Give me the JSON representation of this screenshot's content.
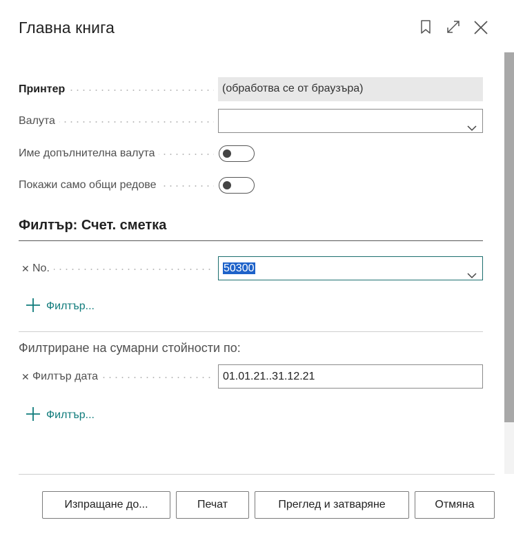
{
  "dialog": {
    "title": "Главна книга"
  },
  "header_icons": [
    "bookmark-icon",
    "expand-icon",
    "close-icon"
  ],
  "options": {
    "printer": {
      "label": "Принтер",
      "value": "(обработва се от браузъра)"
    },
    "currency": {
      "label": "Валута",
      "value": ""
    },
    "addl_currency_name": {
      "label": "Име допълнителна валута",
      "checked": false
    },
    "totals_only": {
      "label": "Покажи само общи редове",
      "checked": false
    }
  },
  "filter_section": {
    "title": "Филтър: Счет. сметка",
    "no_filter": {
      "label": "No.",
      "value": "50300"
    },
    "add_filter_label": "Филтър..."
  },
  "totals_section": {
    "title": "Филтриране на сумарни стойности по:",
    "date_filter": {
      "label": "Филтър дата",
      "value": "01.01.21..31.12.21"
    },
    "add_filter_label": "Филтър..."
  },
  "buttons": {
    "send_to": "Изпращане до...",
    "print": "Печат",
    "preview_close": "Преглед и затваряне",
    "cancel": "Отмяна"
  },
  "colors": {
    "accent": "#0f7b7b",
    "selection": "#1e62c9"
  }
}
